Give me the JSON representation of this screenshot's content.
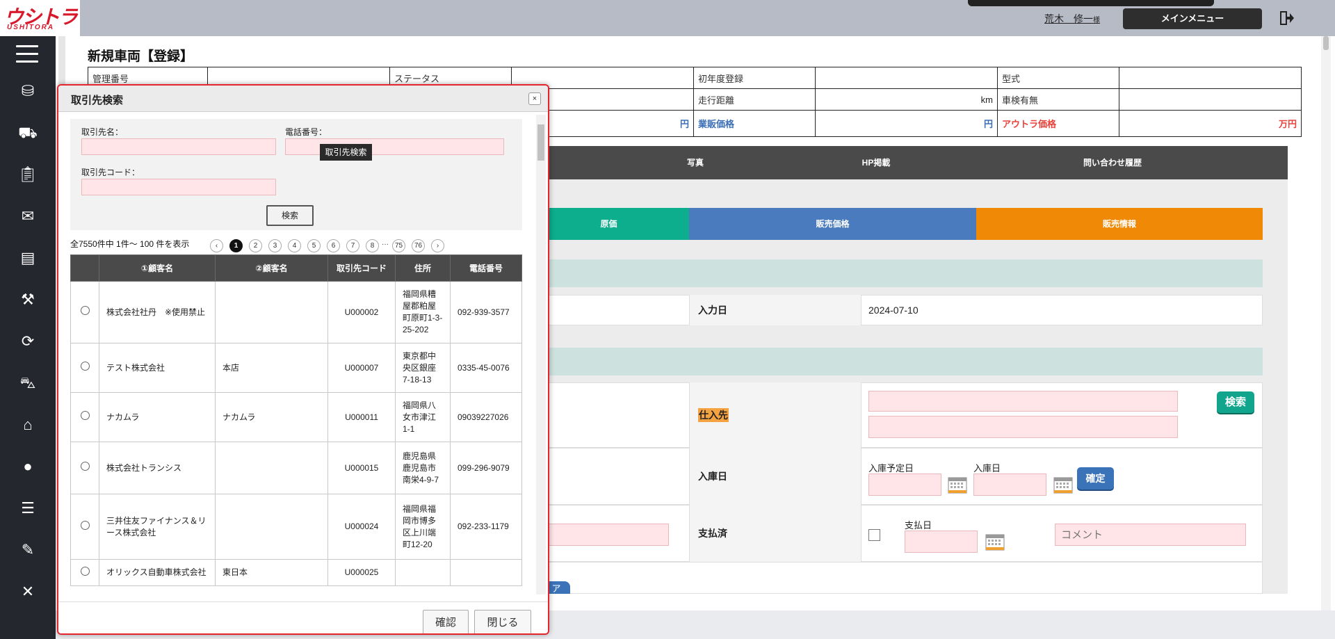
{
  "brand": {
    "logo_main": "ウシトラ",
    "logo_sub": "USHITORA"
  },
  "header": {
    "user_name": "荒木　修一",
    "user_suffix": "様",
    "main_menu": "メインメニュー"
  },
  "page": {
    "title": "新規車両【登録】"
  },
  "summary": {
    "r1": [
      "管理番号",
      "",
      "ステータス",
      "",
      "初年度登録",
      "",
      "型式",
      ""
    ],
    "r2": [
      "走行距離",
      "km",
      "車検有無",
      ""
    ],
    "r3": [
      "円",
      "業販価格",
      "円",
      "アウトラ価格",
      "万円"
    ]
  },
  "tabs": [
    "写真",
    "HP掲載",
    "問い合わせ履歴"
  ],
  "color_tabs": [
    "原価",
    "販売価格",
    "販売情報"
  ],
  "form": {
    "input_date_label": "入力日",
    "input_date_value": "2024-07-10",
    "supplier_label": "仕入先",
    "search_btn": "検索",
    "stock_label": "入庫日",
    "planned_stock": "入庫予定日",
    "stock_day": "入庫日",
    "confirm_btn": "確定",
    "paid_label": "支払済",
    "pay_day": "支払日",
    "comment_placeholder": "コメント",
    "partial_btn": "ア"
  },
  "modal": {
    "title": "取引先検索",
    "close": "×",
    "fields": {
      "name": "取引先名：",
      "phone": "電話番号：",
      "code": "取引先コード："
    },
    "search_btn": "検索",
    "tooltip": "取引先検索",
    "count_text": "全7550件中 1件～ 100 件を表示",
    "pager": {
      "prev": "‹",
      "pages": [
        "1",
        "2",
        "3",
        "4",
        "5",
        "6",
        "7",
        "8"
      ],
      "dots": "···",
      "last": [
        "75",
        "76"
      ],
      "next": "›"
    },
    "columns": [
      "①顧客名",
      "②顧客名",
      "取引先コード",
      "住所",
      "電話番号"
    ],
    "rows": [
      {
        "name1": "株式会社社丹　※使用禁止",
        "name2": "",
        "code": "U000002",
        "address": "福岡県糟屋郡粕屋町原町1-3-25-202",
        "phone": "092-939-3577"
      },
      {
        "name1": "テスト株式会社",
        "name2": "本店",
        "code": "U000007",
        "address": "東京都中央区銀座7-18-13",
        "phone": "0335-45-0076"
      },
      {
        "name1": "ナカムラ",
        "name2": "ナカムラ",
        "code": "U000011",
        "address": "福岡県八女市津江1-1",
        "phone": "09039227026"
      },
      {
        "name1": "株式会社トランシス",
        "name2": "",
        "code": "U000015",
        "address": "鹿児島県鹿児島市南栄4-9-7",
        "phone": "099-296-9079"
      },
      {
        "name1": "三井住友ファイナンス＆リース株式会社",
        "name2": "",
        "code": "U000024",
        "address": "福岡県福岡市博多区上川端町12-20",
        "phone": "092-233-1179"
      },
      {
        "name1": "オリックス自動車株式会社",
        "name2": "東日本",
        "code": "U000025",
        "address": "",
        "phone": ""
      }
    ],
    "ok_btn": "確認",
    "close_btn": "閉じる"
  },
  "colors": {
    "green": "#0cae8e",
    "blue": "#4a7bbe",
    "orange": "#f08a06",
    "accent_red": "#e5242e"
  }
}
